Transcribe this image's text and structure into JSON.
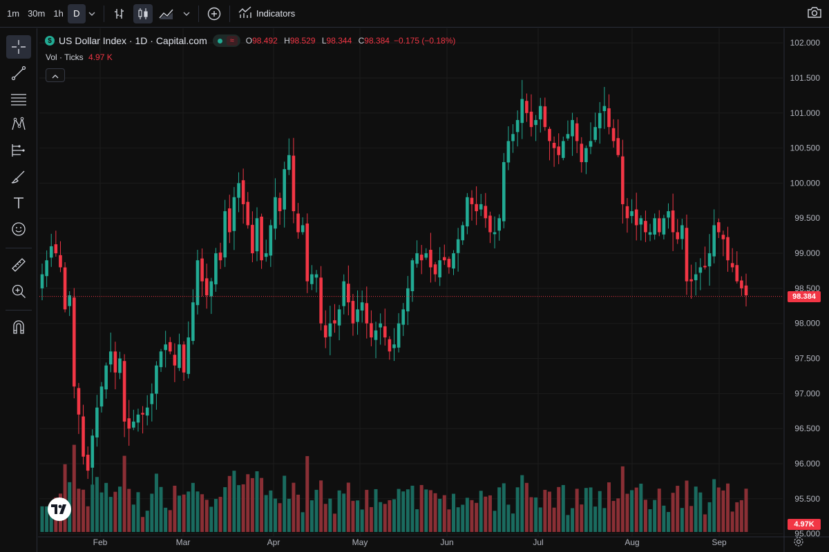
{
  "toolbar": {
    "timeframes": [
      "1m",
      "30m",
      "1h",
      "D"
    ],
    "active_timeframe": "D",
    "indicators_label": "Indicators"
  },
  "legend": {
    "symbol_badge": "$",
    "title": "US Dollar Index · 1D · Capital.com",
    "open_label": "O",
    "open": "98.492",
    "high_label": "H",
    "high": "98.529",
    "low_label": "L",
    "low": "98.344",
    "close_label": "C",
    "close": "98.384",
    "change": "−0.175 (−0.18%)",
    "volume_label": "Vol · Ticks",
    "volume_value": "4.97 K"
  },
  "price_tag": "98.384",
  "volume_tag": "4.97K",
  "colors": {
    "up": "#22ab94",
    "down": "#f23645",
    "up_volume": "#1a6b5f",
    "down_volume": "#8a2f35",
    "background": "#0f0f0f",
    "grid": "#1c1c1c"
  },
  "icons": {
    "top": [
      "bar-chart-icon",
      "candles-icon",
      "area-chart-icon",
      "chevron-down-icon",
      "plus-circle-icon",
      "indicators-icon",
      "camera-icon"
    ],
    "left": [
      "crosshair-icon",
      "trend-line-icon",
      "fib-icon",
      "pattern-icon",
      "projection-icon",
      "brush-icon",
      "text-icon",
      "emoji-icon",
      "ruler-icon",
      "zoom-in-icon",
      "magnet-icon"
    ]
  },
  "chart_data": {
    "type": "candlestick",
    "title": "US Dollar Index · 1D · Capital.com",
    "y_ticks": [
      "102.000",
      "101.500",
      "101.000",
      "100.500",
      "100.000",
      "99.500",
      "99.000",
      "98.500",
      "98.000",
      "97.500",
      "97.000",
      "96.500",
      "96.000",
      "95.500",
      "95.000"
    ],
    "ylim": [
      94.75,
      102.1
    ],
    "x_ticks": [
      "Feb",
      "Mar",
      "Apr",
      "May",
      "Jun",
      "Jul",
      "Aug",
      "Sep"
    ],
    "grid": true,
    "last_price": 98.384,
    "candles_close": [
      98.7,
      98.9,
      99.1,
      99.0,
      98.8,
      98.2,
      98.4,
      97.1,
      96.7,
      96.1,
      95.9,
      96.4,
      96.8,
      97.1,
      97.4,
      97.6,
      97.3,
      97.5,
      96.6,
      96.5,
      96.6,
      96.7,
      96.7,
      96.8,
      97.0,
      97.4,
      97.6,
      97.7,
      97.6,
      97.4,
      97.7,
      97.3,
      97.8,
      98.3,
      98.9,
      98.6,
      98.4,
      98.6,
      99.0,
      98.9,
      99.6,
      99.3,
      99.8,
      100.0,
      99.7,
      99.4,
      99.0,
      99.5,
      98.9,
      99.0,
      99.4,
      99.8,
      99.6,
      100.2,
      100.4,
      99.6,
      99.3,
      99.4,
      98.6,
      98.7,
      98.7,
      98.0,
      97.8,
      98.0,
      98.0,
      98.2,
      98.6,
      98.3,
      98.0,
      98.2,
      98.3,
      98.0,
      97.8,
      97.9,
      98.0,
      97.8,
      97.6,
      97.7,
      98.0,
      98.2,
      98.5,
      98.9,
      99.0,
      98.9,
      99.0,
      98.8,
      98.7,
      98.9,
      98.9,
      98.8,
      99.0,
      99.2,
      99.4,
      99.8,
      99.7,
      99.6,
      99.7,
      99.5,
      99.3,
      99.3,
      99.5,
      100.3,
      100.6,
      100.7,
      100.9,
      101.2,
      101.0,
      100.8,
      100.9,
      101.1,
      100.8,
      100.6,
      100.5,
      100.4,
      100.6,
      100.7,
      100.9,
      100.6,
      100.3,
      100.5,
      100.6,
      100.8,
      101.0,
      101.1,
      100.8,
      100.6,
      100.4,
      99.7,
      99.5,
      99.6,
      99.4,
      99.5,
      99.3,
      99.3,
      99.5,
      99.3,
      99.5,
      99.6,
      99.3,
      99.2,
      99.4,
      98.6,
      98.6,
      98.7,
      98.8,
      98.8,
      99.0,
      99.4,
      99.3,
      99.2,
      98.9,
      98.8,
      98.6,
      98.5,
      98.4
    ],
    "volume_unit": "K ticks",
    "last_volume": 4.97
  }
}
